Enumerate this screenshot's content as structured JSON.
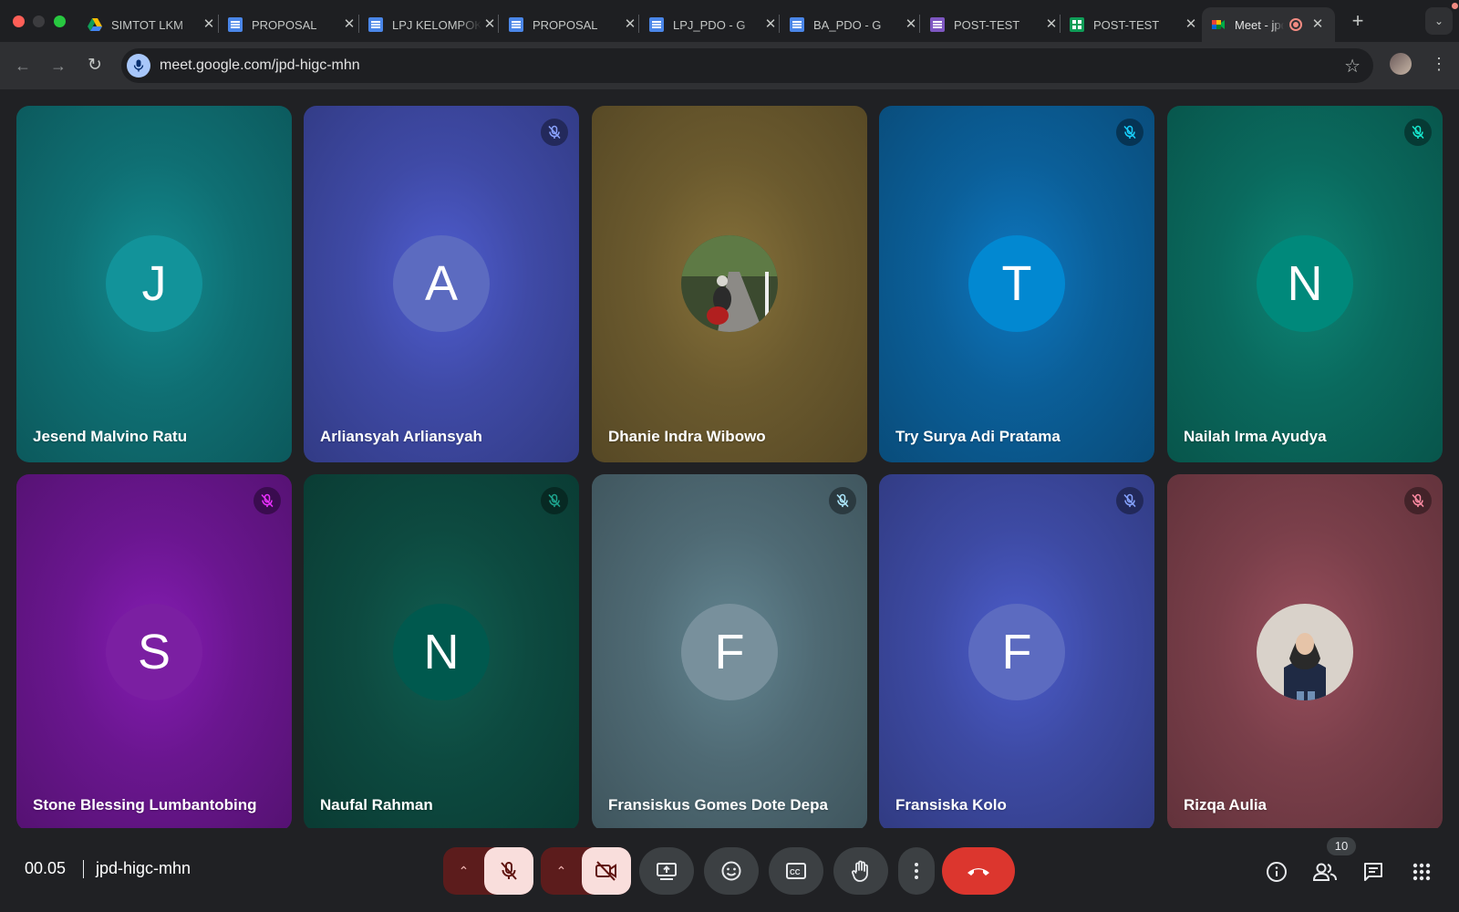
{
  "browser": {
    "tabs": [
      {
        "title": "SIMTOT LKM",
        "icon": "google-drive-icon"
      },
      {
        "title": "PROPOSAL",
        "icon": "google-docs-icon"
      },
      {
        "title": "LPJ KELOMPOK",
        "icon": "google-docs-icon"
      },
      {
        "title": "PROPOSAL",
        "icon": "google-docs-icon"
      },
      {
        "title": "LPJ_PDO - G",
        "icon": "google-docs-icon"
      },
      {
        "title": "BA_PDO - G",
        "icon": "google-docs-icon"
      },
      {
        "title": "POST-TEST",
        "icon": "google-forms-icon"
      },
      {
        "title": "POST-TEST",
        "icon": "google-sheets-icon"
      },
      {
        "title": "Meet - jpd",
        "icon": "google-meet-icon",
        "active": true,
        "recording": true
      }
    ],
    "url": "meet.google.com/jpd-higc-mhn"
  },
  "participants": [
    {
      "name": "Jesend Malvino Ratu",
      "initial": "J",
      "muted": false,
      "avatar_color": "#12939a",
      "tile_color": "#0f6f73"
    },
    {
      "name": "Arliansyah Arliansyah",
      "initial": "A",
      "muted": true,
      "avatar_color": "#5c6bc0",
      "tile_color": "#3f4aa6"
    },
    {
      "name": "Dhanie Indra Wibowo",
      "initial": "",
      "muted": false,
      "photo": true,
      "tile_color": "#6b5a2e"
    },
    {
      "name": "Try Surya Adi Pratama",
      "initial": "T",
      "muted": true,
      "avatar_color": "#0288d1",
      "tile_color": "#0b5f99"
    },
    {
      "name": "Nailah Irma Ayudya",
      "initial": "N",
      "muted": true,
      "avatar_color": "#00897b",
      "tile_color": "#0a6a5e"
    },
    {
      "name": "Stone Blessing Lumbantobing",
      "initial": "S",
      "muted": true,
      "avatar_color": "#7b1fa2",
      "tile_color": "#6a168f"
    },
    {
      "name": "Naufal Rahman",
      "initial": "N",
      "muted": true,
      "avatar_color": "#00594e",
      "tile_color": "#0d4a40"
    },
    {
      "name": "Fransiskus Gomes Dote Depa",
      "initial": "F",
      "muted": true,
      "avatar_color": "#78909c",
      "tile_color": "#4f6a74"
    },
    {
      "name": "Fransiska Kolo",
      "initial": "F",
      "muted": true,
      "avatar_color": "#5c6bc0",
      "tile_color": "#3d4aa3"
    },
    {
      "name": "Rizqa Aulia",
      "initial": "",
      "muted": true,
      "photo": true,
      "tile_color": "#7a3f4a"
    }
  ],
  "meeting": {
    "time": "00.05",
    "code": "jpd-higc-mhn",
    "participant_count": "10"
  },
  "colors": {
    "end_call": "#dc362e",
    "off_button_bg": "#f9dedc",
    "off_group_bg": "#5c1c1c"
  }
}
